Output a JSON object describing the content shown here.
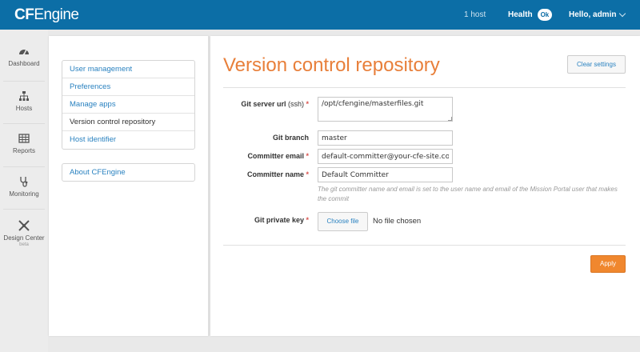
{
  "header": {
    "logo_bold": "CF",
    "logo_rest": "Engine",
    "hosts": "1 host",
    "health_label": "Health",
    "health_status": "Ok",
    "user_greeting": "Hello, admin"
  },
  "leftnav": {
    "items": [
      {
        "label": "Dashboard",
        "icon": "dashboard-icon"
      },
      {
        "label": "Hosts",
        "icon": "hosts-icon"
      },
      {
        "label": "Reports",
        "icon": "reports-icon"
      },
      {
        "label": "Monitoring",
        "icon": "monitoring-icon"
      },
      {
        "label": "Design Center",
        "icon": "design-center-icon",
        "badge": "beta"
      }
    ]
  },
  "settings_menu": {
    "items": [
      {
        "label": "User management",
        "active": false
      },
      {
        "label": "Preferences",
        "active": false
      },
      {
        "label": "Manage apps",
        "active": false
      },
      {
        "label": "Version control repository",
        "active": true
      },
      {
        "label": "Host identifier",
        "active": false
      }
    ],
    "about": "About CFEngine"
  },
  "main": {
    "title": "Version control repository",
    "clear_button": "Clear settings",
    "fields": {
      "git_server_label": "Git server url",
      "git_server_label_suffix": "(ssh)",
      "git_server_value": "/opt/cfengine/masterfiles.git",
      "git_branch_label": "Git branch",
      "git_branch_value": "master",
      "committer_email_label": "Committer email",
      "committer_email_value": "default-committer@your-cfe-site.com",
      "committer_name_label": "Committer name",
      "committer_name_value": "Default Committer",
      "hint": "The git committer name and email is set to the user name and email of the Mission Portal user that makes the commit",
      "private_key_label": "Git private key",
      "choose_file": "Choose file",
      "no_file": "No file chosen",
      "required_mark": "*"
    },
    "apply_button": "Apply"
  },
  "colors": {
    "header_bg": "#0c6ea6",
    "title_orange": "#e87f3a",
    "link_blue": "#2a82c0",
    "apply_orange": "#f0872e",
    "required_red": "#d9534f"
  }
}
